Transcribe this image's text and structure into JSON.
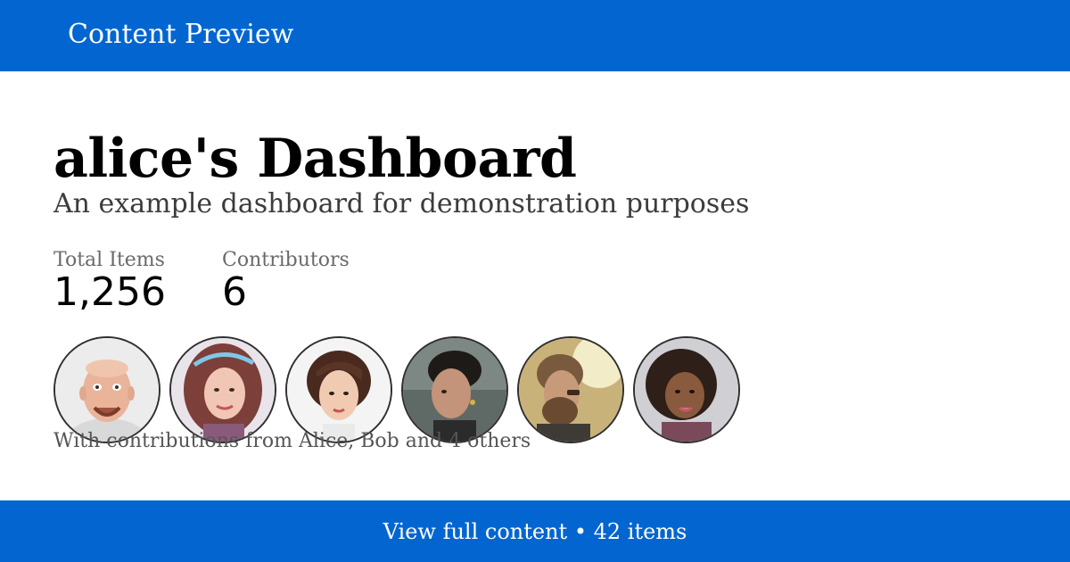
{
  "header": {
    "brand": "Content Preview",
    "accent_color": "#0366d0"
  },
  "dashboard": {
    "title": "alice's Dashboard",
    "subtitle": "An example dashboard for demonstration purposes"
  },
  "stats": [
    {
      "label": "Total Items",
      "value": "1,256"
    },
    {
      "label": "Contributors",
      "value": "6"
    }
  ],
  "contributors": {
    "avatars": [
      {
        "name": "avatar-1-icon"
      },
      {
        "name": "avatar-2-icon"
      },
      {
        "name": "avatar-3-icon"
      },
      {
        "name": "avatar-4-icon"
      },
      {
        "name": "avatar-5-icon"
      },
      {
        "name": "avatar-6-icon"
      }
    ],
    "summary": "With contributions from Alice, Bob and 4 others"
  },
  "footer": {
    "cta": "View full content • 42 items"
  }
}
